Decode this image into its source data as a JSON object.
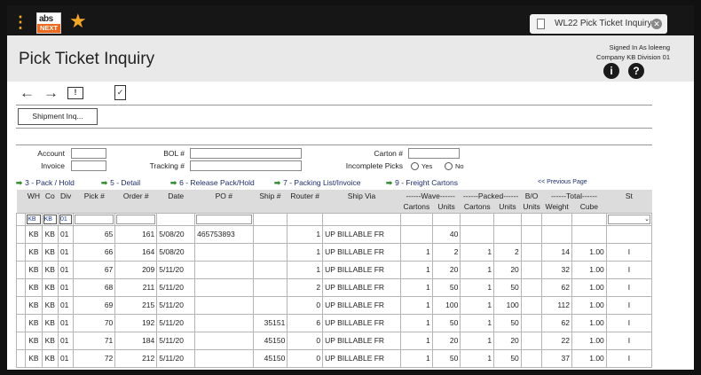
{
  "app": {
    "logo_top": "abs",
    "logo_bottom": "NEXT",
    "tab_label": "WL22 Pick Ticket Inquiry",
    "close_glyph": "✕"
  },
  "header": {
    "title": "Pick Ticket Inquiry",
    "signed_in": "Signed In As loleeng",
    "company": "Company KB Division 01",
    "info_glyph": "i",
    "help_glyph": "?"
  },
  "toolbar": {
    "back_glyph": "←",
    "forward_glyph": "→",
    "note_glyph": "!",
    "clipboard_glyph": "✓"
  },
  "shipment_button": "Shipment Inq...",
  "form": {
    "account_label": "Account",
    "invoice_label": "Invoice",
    "bol_label": "BOL #",
    "tracking_label": "Tracking #",
    "carton_label": "Carton #",
    "incomplete_label": "Incomplete Picks",
    "yes_label": "Yes",
    "no_label": "No"
  },
  "links": {
    "pack_hold": "3 - Pack / Hold",
    "detail": "5 - Detail",
    "release": "6 - Release Pack/Hold",
    "packing_list": "7 - Packing List/Invoice",
    "freight": "9 - Freight Cartons",
    "previous": "<< Previous Page"
  },
  "table": {
    "headers": {
      "wh": "WH",
      "co": "Co",
      "div": "Div",
      "pick": "Pick #",
      "order": "Order #",
      "date": "Date",
      "po": "PO #",
      "ship": "Ship #",
      "router": "Router #",
      "shipvia": "Ship Via",
      "wave": "------Wave------",
      "packed": "------Packed------",
      "bo": "B/O",
      "total": "------Total------",
      "st": "St",
      "cartons": "Cartons",
      "units": "Units",
      "weight": "Weight",
      "cube": "Cube"
    },
    "filter": {
      "wh": "KB",
      "co": "KB",
      "div": "01"
    },
    "rows": [
      {
        "wh": "KB",
        "co": "KB",
        "div": "01",
        "pick": "65",
        "order": "161",
        "date": "5/08/20",
        "po": "465753893",
        "ship": "",
        "router": "1",
        "via": "UP BILLABLE FR",
        "wc": "",
        "wu": "40",
        "pc": "",
        "pu": "",
        "bo": "",
        "weight": "",
        "cube": "",
        "st": ""
      },
      {
        "wh": "KB",
        "co": "KB",
        "div": "01",
        "pick": "66",
        "order": "164",
        "date": "5/08/20",
        "po": "",
        "ship": "",
        "router": "1",
        "via": "UP BILLABLE FR",
        "wc": "1",
        "wu": "2",
        "pc": "1",
        "pu": "2",
        "bo": "",
        "weight": "14",
        "cube": "1.00",
        "st": "I"
      },
      {
        "wh": "KB",
        "co": "KB",
        "div": "01",
        "pick": "67",
        "order": "209",
        "date": "5/11/20",
        "po": "",
        "ship": "",
        "router": "1",
        "via": "UP BILLABLE FR",
        "wc": "1",
        "wu": "20",
        "pc": "1",
        "pu": "20",
        "bo": "",
        "weight": "32",
        "cube": "1.00",
        "st": "I"
      },
      {
        "wh": "KB",
        "co": "KB",
        "div": "01",
        "pick": "68",
        "order": "211",
        "date": "5/11/20",
        "po": "",
        "ship": "",
        "router": "2",
        "via": "UP BILLABLE FR",
        "wc": "1",
        "wu": "50",
        "pc": "1",
        "pu": "50",
        "bo": "",
        "weight": "62",
        "cube": "1.00",
        "st": "I"
      },
      {
        "wh": "KB",
        "co": "KB",
        "div": "01",
        "pick": "69",
        "order": "215",
        "date": "5/11/20",
        "po": "",
        "ship": "",
        "router": "0",
        "via": "UP BILLABLE FR",
        "wc": "1",
        "wu": "100",
        "pc": "1",
        "pu": "100",
        "bo": "",
        "weight": "112",
        "cube": "1.00",
        "st": "I"
      },
      {
        "wh": "KB",
        "co": "KB",
        "div": "01",
        "pick": "70",
        "order": "192",
        "date": "5/11/20",
        "po": "",
        "ship": "35151",
        "router": "6",
        "via": "UP BILLABLE FR",
        "wc": "1",
        "wu": "50",
        "pc": "1",
        "pu": "50",
        "bo": "",
        "weight": "62",
        "cube": "1.00",
        "st": "I"
      },
      {
        "wh": "KB",
        "co": "KB",
        "div": "01",
        "pick": "71",
        "order": "184",
        "date": "5/11/20",
        "po": "",
        "ship": "45150",
        "router": "0",
        "via": "UP BILLABLE FR",
        "wc": "1",
        "wu": "20",
        "pc": "1",
        "pu": "20",
        "bo": "",
        "weight": "22",
        "cube": "1.00",
        "st": "I"
      },
      {
        "wh": "KB",
        "co": "KB",
        "div": "01",
        "pick": "72",
        "order": "212",
        "date": "5/11/20",
        "po": "",
        "ship": "45150",
        "router": "0",
        "via": "UP BILLABLE FR",
        "wc": "1",
        "wu": "50",
        "pc": "1",
        "pu": "50",
        "bo": "",
        "weight": "37",
        "cube": "1.00",
        "st": "I"
      }
    ]
  },
  "colors": {
    "accent": "#f5a623",
    "logo_orange": "#f06a1e",
    "link": "#1c2e6e",
    "link_arrow": "#2e8b2e",
    "topbar": "#161616"
  }
}
